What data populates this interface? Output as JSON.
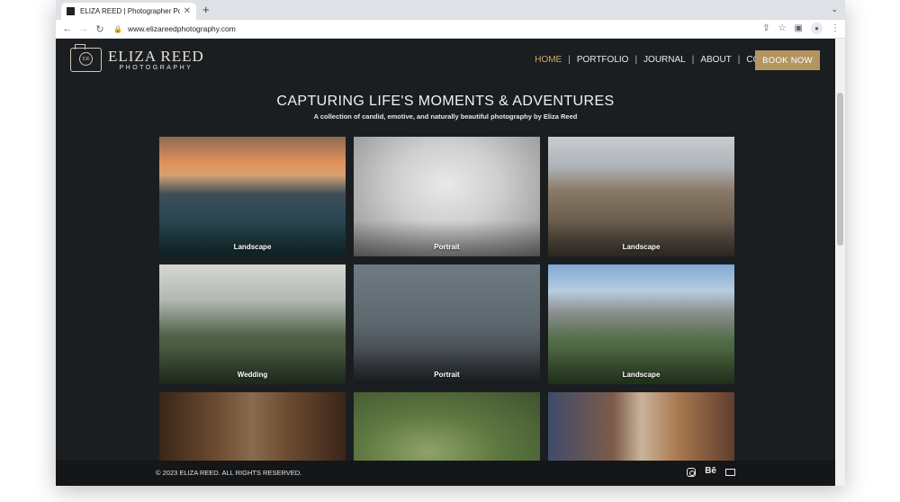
{
  "browser": {
    "tab_title": "ELIZA REED | Photographer Portfolio",
    "tab_close": "✕",
    "new_tab": "+",
    "url": "www.elizareedphotography.com"
  },
  "site": {
    "logo_name": "ELIZA REED",
    "logo_sub": "PHOTOGRAPHY",
    "logo_mark": "ER",
    "nav": [
      "HOME",
      "PORTFOLIO",
      "JOURNAL",
      "ABOUT",
      "CONTACT"
    ],
    "nav_separator": "|",
    "book_now": "BOOK NOW",
    "hero_title": "CAPTURING LIFE'S MOMENTS & ADVENTURES",
    "hero_subtitle": "A collection of candid, emotive, and naturally beautiful photography by Eliza Reed",
    "gallery": [
      {
        "label": "Landscape"
      },
      {
        "label": "Portrait"
      },
      {
        "label": "Landscape"
      },
      {
        "label": "Wedding"
      },
      {
        "label": "Portrait"
      },
      {
        "label": "Landscape"
      },
      {
        "label": ""
      },
      {
        "label": ""
      },
      {
        "label": ""
      }
    ],
    "footer_copyright": "© 2023 ELIZA REED. ALL RIGHTS RESERVED.",
    "footer_behance": "Bē"
  },
  "colors": {
    "background": "#1b1e21",
    "accent": "#b49561",
    "active_nav": "#c9a96e"
  }
}
